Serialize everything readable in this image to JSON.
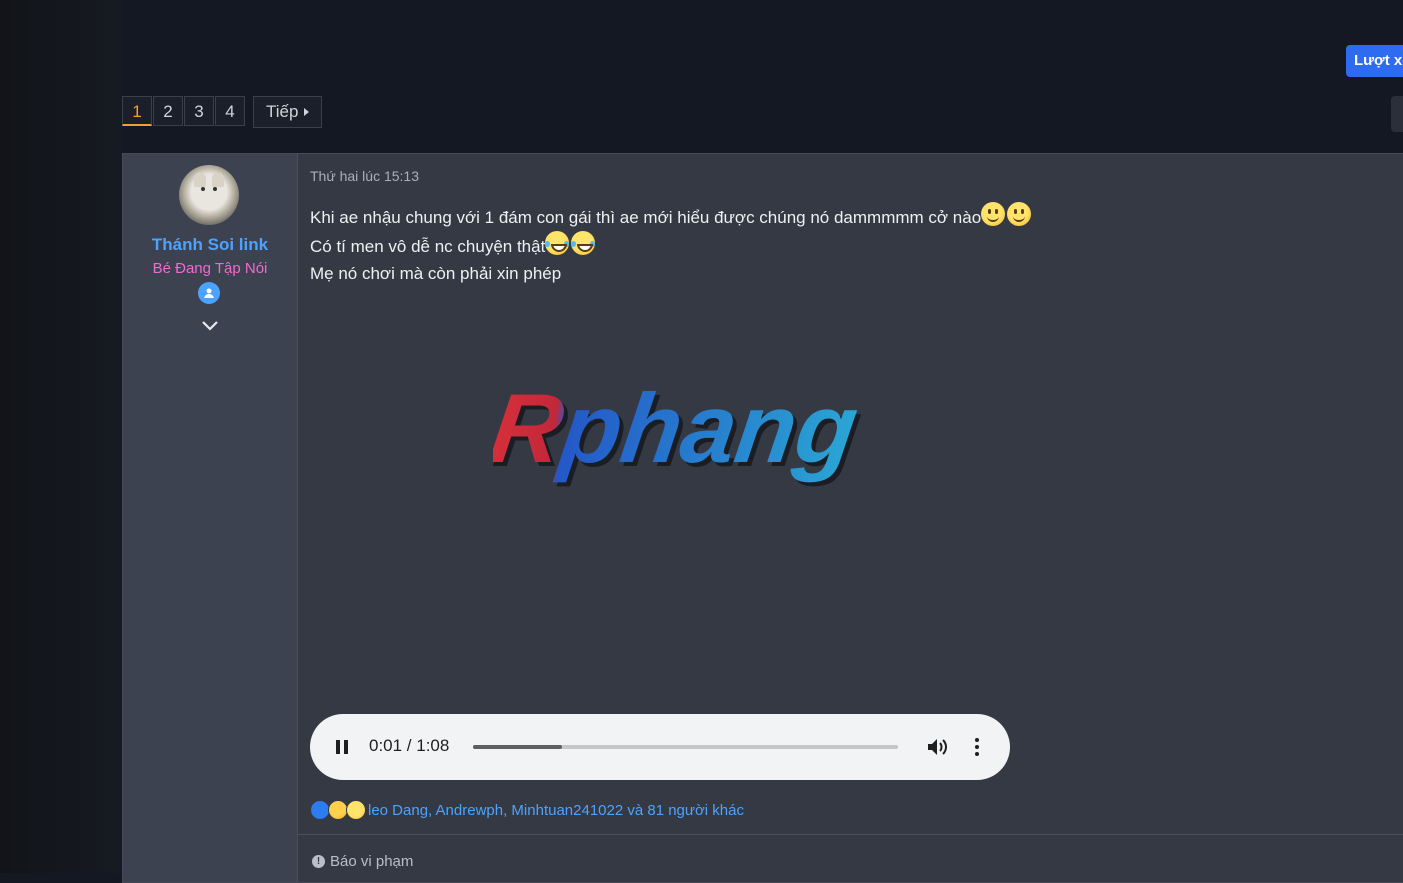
{
  "header": {
    "views_button": "Lượt xem"
  },
  "pagination": {
    "pages": [
      "1",
      "2",
      "3",
      "4"
    ],
    "active_page": "1",
    "next_label": "Tiếp"
  },
  "user": {
    "name": "Thánh Soi link",
    "title": "Bé Đang Tập Nói",
    "name_color": "#4ba3ff",
    "title_color": "#f06ad0"
  },
  "post": {
    "date": "Thứ hai lúc 15:13",
    "lines": [
      "Khi ae nhậu chung với 1 đám con gái thì ae mới hiểu được chúng nó dammmmm cở nào",
      "Có tí men vô dễ nc chuyện thật",
      "Mẹ nó chơi mà còn phải xin phép"
    ],
    "logo_text": "Rphang",
    "emoji": {
      "line1": [
        "slightly-smiling-face",
        "slightly-smiling-face"
      ],
      "line2": [
        "tears-of-joy",
        "tears-of-joy"
      ]
    }
  },
  "audio": {
    "time": "0:01 / 1:08",
    "progress_fraction": 0.21
  },
  "reactions": {
    "icons": [
      "like-icon",
      "love-icon",
      "haha-icon"
    ],
    "text": "leo Dang, Andrewph, Minhtuan241022 và 81 người khác"
  },
  "footer": {
    "report_label": "Báo vi phạm"
  }
}
